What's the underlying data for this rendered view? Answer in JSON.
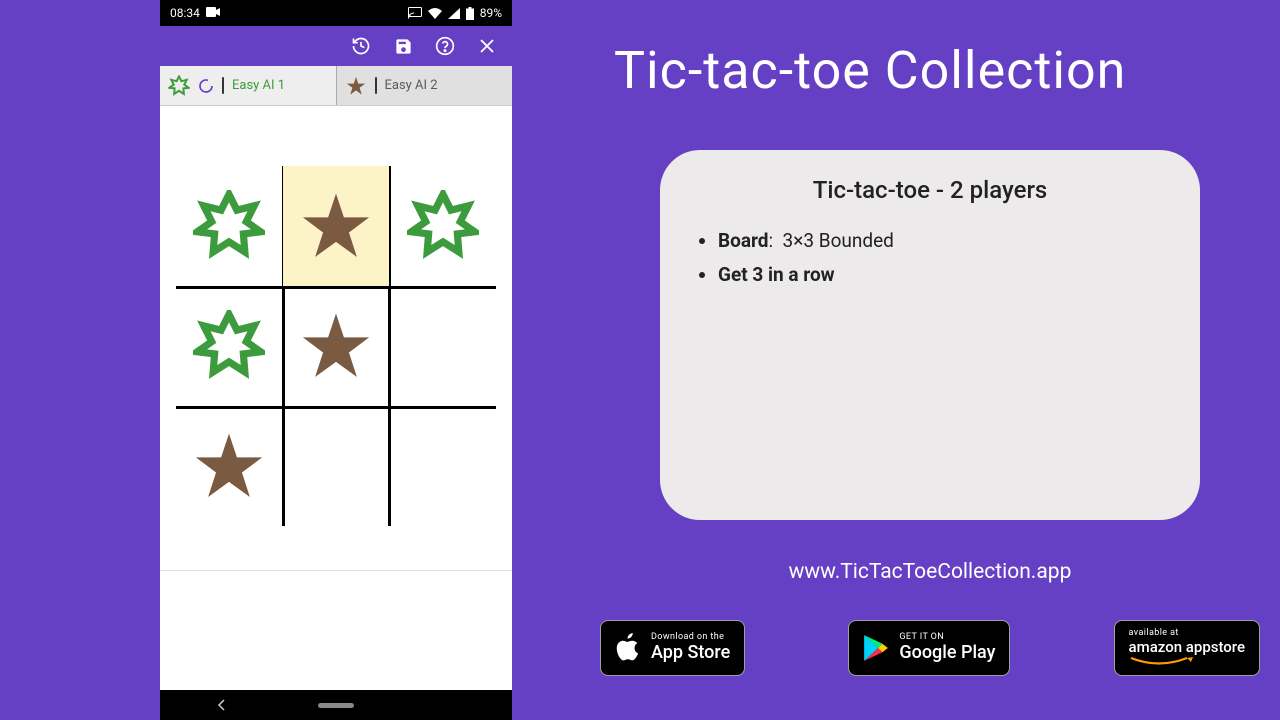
{
  "status": {
    "time": "08:34",
    "battery": "89%"
  },
  "players": {
    "p1": {
      "name": "Easy AI 1"
    },
    "p2": {
      "name": "Easy AI 2"
    }
  },
  "board": {
    "cells": [
      [
        "green",
        "brown",
        "green"
      ],
      [
        "green",
        "brown",
        ""
      ],
      [
        "brown",
        "",
        ""
      ]
    ],
    "highlight": [
      0,
      1
    ]
  },
  "promo": {
    "title": "Tic-tac-toe Collection",
    "card": {
      "heading": "Tic-tac-toe - 2 players",
      "board_label": "Board",
      "board_value": "3×3 Bounded",
      "rule": "Get 3 in a row"
    },
    "website": "www.TicTacToeCollection.app",
    "stores": {
      "apple": {
        "top": "Download on the",
        "bottom": "App Store"
      },
      "google": {
        "top": "GET IT ON",
        "bottom": "Google Play"
      },
      "amazon": {
        "top": "available at",
        "bottom": "amazon appstore"
      }
    }
  }
}
